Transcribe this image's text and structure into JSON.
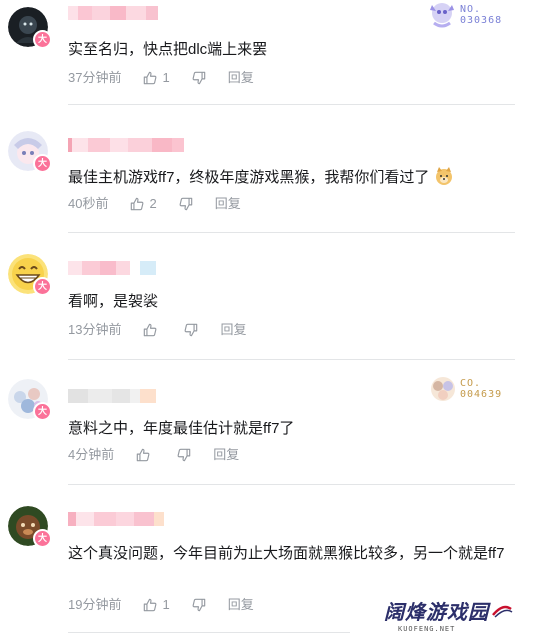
{
  "comments": [
    {
      "text": "实至名归，快点把dlc端上来罢",
      "time": "37分钟前",
      "likes": "1",
      "reply": "回复",
      "fan_number": "NO.\n030368"
    },
    {
      "text": "最佳主机游戏ff7，终极年度游戏黑猴，我帮你们看过了",
      "time": "40秒前",
      "likes": "2",
      "reply": "回复"
    },
    {
      "text": "看啊，是袈裟",
      "time": "13分钟前",
      "likes": "",
      "reply": "回复"
    },
    {
      "text": "意料之中，年度最佳估计就是ff7了",
      "time": "4分钟前",
      "likes": "",
      "reply": "回复",
      "fan_number": "CO.\n004639"
    },
    {
      "text": "这个真没问题，今年目前为止大场面就黑猴比较多，另一个就是ff7",
      "time": "19分钟前",
      "likes": "1",
      "reply": "回复"
    }
  ],
  "badge_label": "大",
  "watermark": {
    "title": "阔烽游戏园",
    "subtitle": "KUOFENG.NET"
  },
  "colors": {
    "accent": "#fb7299",
    "meta": "#9499a0",
    "divider": "#e3e5e7"
  }
}
